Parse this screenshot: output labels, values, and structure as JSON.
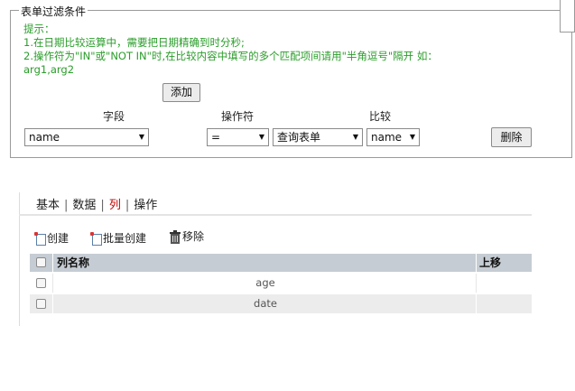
{
  "filter": {
    "legend": "表单过滤条件",
    "hint_title": "提示：",
    "hint_line1": "1.在日期比较运算中，需要把日期精确到时分秒;",
    "hint_line2": "2.操作符为\"IN\"或\"NOT IN\"时,在比较内容中填写的多个匹配项间请用\"半角逗号\"隔开 如：",
    "hint_line3": "arg1,arg2",
    "add_button": "添加",
    "col_field": "字段",
    "col_operator": "操作符",
    "col_compare": "比较",
    "field_value": "name",
    "operator_value": "=",
    "compare_type_value": "查询表单",
    "compare_field_value": "name",
    "delete_button": "删除"
  },
  "tabs": [
    {
      "label": "基本"
    },
    {
      "label": "数据"
    },
    {
      "label": "列"
    },
    {
      "label": "操作"
    }
  ],
  "toolbar": {
    "create": "创建",
    "batch_create": "批量创建",
    "remove": "移除"
  },
  "grid": {
    "headers": [
      "列名称",
      "上移"
    ],
    "rows": [
      {
        "name": "age"
      },
      {
        "name": "date"
      }
    ]
  },
  "colors": {
    "hint": "#2a9d2a",
    "active_tab": "#c00000",
    "grid_header": "#c6ccd3"
  }
}
